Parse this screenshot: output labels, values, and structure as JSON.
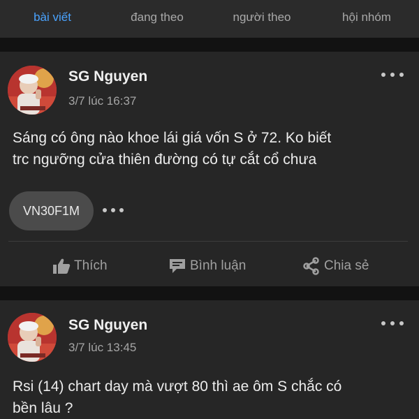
{
  "tabs": [
    {
      "label": "bài viết",
      "active": true
    },
    {
      "label": "đang theo",
      "active": false
    },
    {
      "label": "người theo",
      "active": false
    },
    {
      "label": "hội nhóm",
      "active": false
    }
  ],
  "posts": [
    {
      "author": "SG Nguyen",
      "time": "3/7 lúc 16:37",
      "text_line1": "Sáng có ông  nào khoe lái giá vốn  S ở 72. Ko biết",
      "text_line2": "trc ngưỡng cửa thiên đường có tự cắt cổ chưa",
      "tag": "VN30F1M",
      "actions": {
        "like": "Thích",
        "comment": "Bình luận",
        "share": "Chia sẻ"
      }
    },
    {
      "author": "SG Nguyen",
      "time": "3/7 lúc 13:45",
      "text_line1": "Rsi (14)  chart day mà vượt 80 thì ae ôm S chắc có",
      "text_line2": "bền lâu ?"
    }
  ],
  "colors": {
    "accent": "#4aa3ff",
    "card": "#262626",
    "background": "#121212",
    "tabbar": "#2b2b2b"
  },
  "icons": {
    "like": "thumbs-up-icon",
    "comment": "comment-icon",
    "share": "share-icon",
    "more": "more-dots-icon"
  }
}
